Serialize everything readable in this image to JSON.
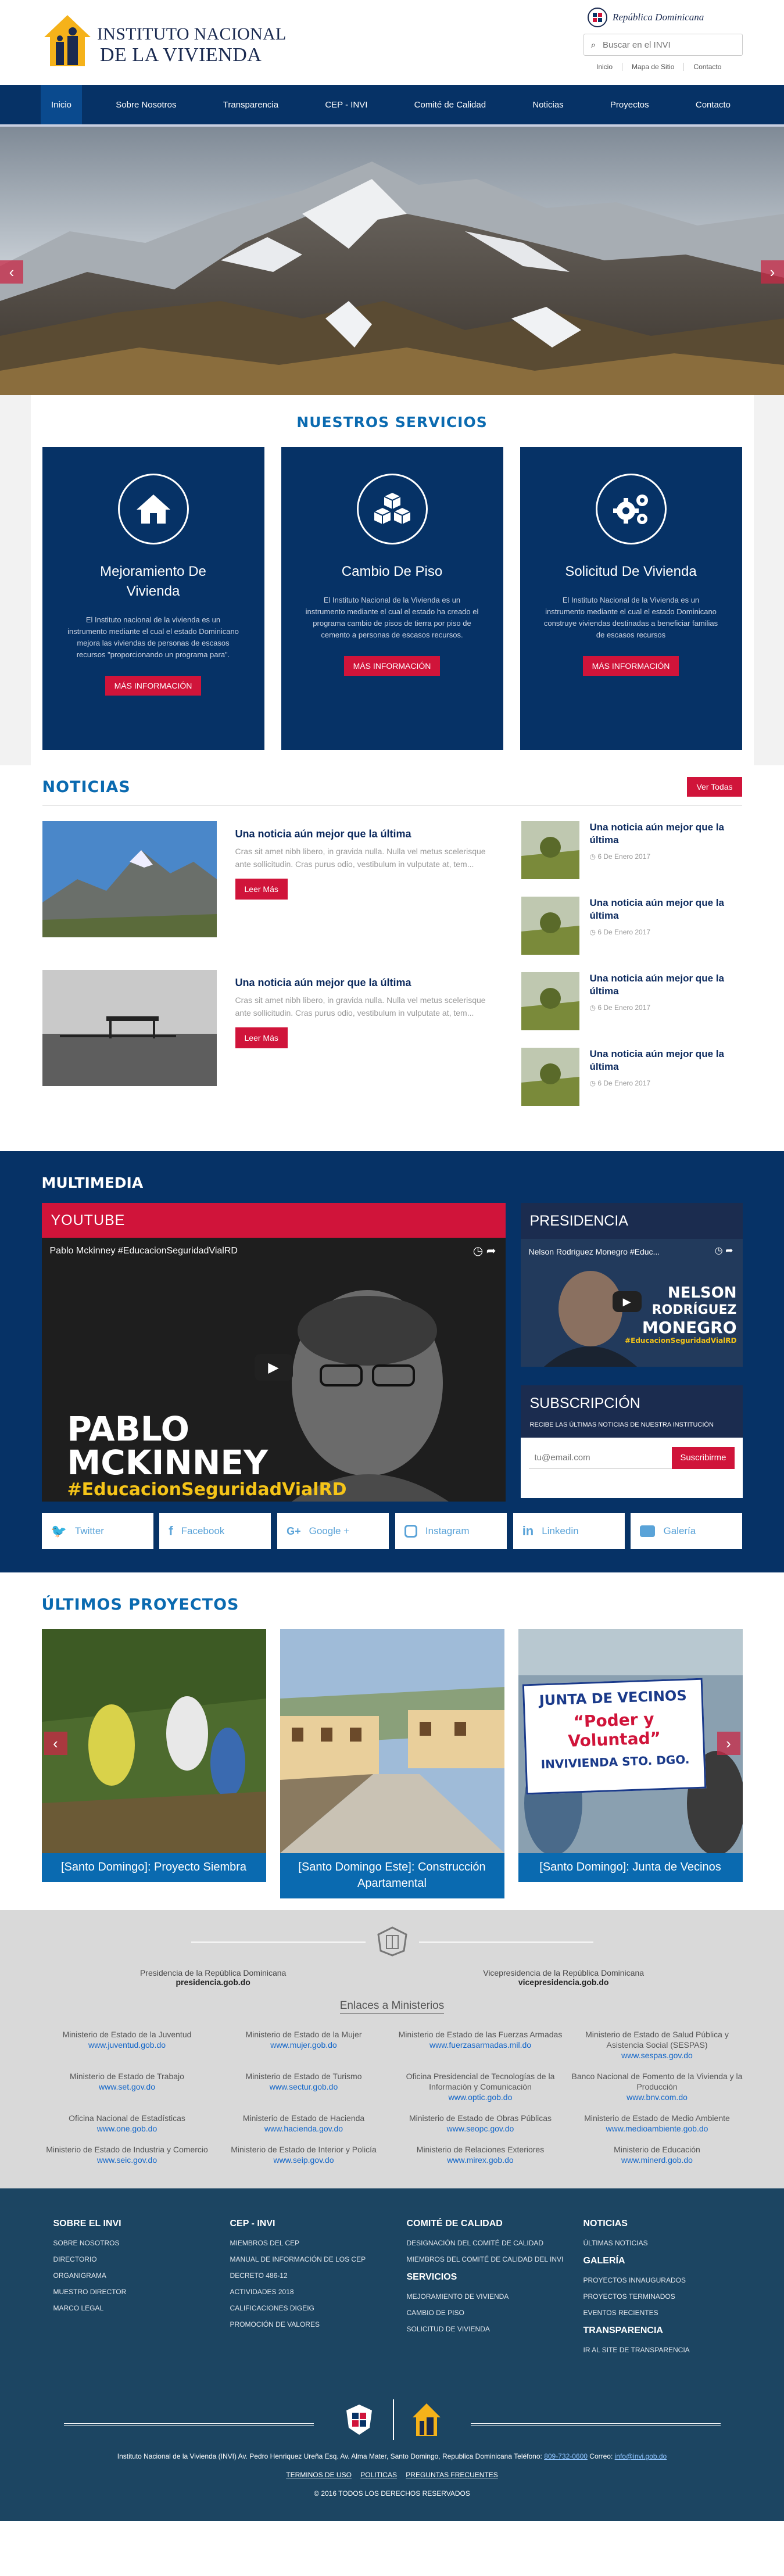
{
  "header": {
    "logo_line1": "INSTITUTO NACIONAL",
    "logo_line2": "DE LA VIVIENDA",
    "rd_label": "República Dominicana",
    "search_placeholder": "Buscar en el INVI",
    "top_links": [
      "Inicio",
      "Mapa de Sitio",
      "Contacto"
    ]
  },
  "nav": [
    "Inicio",
    "Sobre Nosotros",
    "Transparencia",
    "CEP - INVI",
    "Comité de Calidad",
    "Noticias",
    "Proyectos",
    "Contacto"
  ],
  "hero": {
    "prev": "‹",
    "next": "›"
  },
  "services": {
    "title": "NUESTROS SERVICIOS",
    "items": [
      {
        "title": "Mejoramiento De Vivienda",
        "text": "El Instituto nacional de la vivienda es un instrumento mediante el cual el estado Dominicano mejora las viviendas de personas de escasos recursos \"proporcionando un programa para\".",
        "button": "MÁS INFORMACIÓN",
        "icon": "home-icon"
      },
      {
        "title": "Cambio De Piso",
        "text": "El Instituto Nacional de la Vivienda es un instrumento mediante el cual el estado ha creado el programa cambio de pisos de tierra por piso de cemento a personas de escasos recursos.",
        "button": "MÁS INFORMACIÓN",
        "icon": "cubes-icon"
      },
      {
        "title": "Solicitud De Vivienda",
        "text": "El Instituto Nacional de la Vivienda es un instrumento mediante el cual el estado Dominicano construye viviendas destinadas a beneficiar familias de escasos recursos",
        "button": "MÁS INFORMACIÓN",
        "icon": "gears-icon"
      }
    ]
  },
  "news": {
    "title": "NOTICIAS",
    "view_all": "Ver Todas",
    "main": [
      {
        "title": "Una noticia aún mejor que la última",
        "text": "Cras sit amet nibh libero, in gravida nulla. Nulla vel metus scelerisque ante sollicitudin. Cras purus odio, vestibulum in vulputate at, tem...",
        "button": "Leer Más"
      },
      {
        "title": "Una noticia aún mejor que la última",
        "text": "Cras sit amet nibh libero, in gravida nulla. Nulla vel metus scelerisque ante sollicitudin. Cras purus odio, vestibulum in vulputate at, tem...",
        "button": "Leer Más"
      }
    ],
    "side": [
      {
        "title": "Una noticia aún mejor que la última",
        "date": "6 De Enero 2017"
      },
      {
        "title": "Una noticia aún mejor que la última",
        "date": "6 De Enero 2017"
      },
      {
        "title": "Una noticia aún mejor que la última",
        "date": "6 De Enero 2017"
      },
      {
        "title": "Una noticia aún mejor que la última",
        "date": "6 De Enero 2017"
      }
    ]
  },
  "multimedia": {
    "title": "MULTIMEDIA",
    "youtube": {
      "label": "YOUTUBE",
      "video_title": "Pablo Mckinney #EducacionSeguridadVialRD",
      "overlay_name": "PABLO\nMCKINNEY",
      "overlay_tag": "#EducacionSeguridadVialRD"
    },
    "presidencia": {
      "label": "PRESIDENCIA",
      "video_title": "Nelson Rodriguez Monegro #Educ...",
      "overlay_l1": "NELSON",
      "overlay_l2": "RODRÍGUEZ",
      "overlay_l3": "MONEGRO",
      "overlay_tag": "#EducacionSeguridadVialRD"
    },
    "subscription": {
      "label": "SUBSCRIPCIÓN",
      "hint": "RECIBE LAS ÚLTIMAS NOTICIAS DE NUESTRA INSTITUCIÓN",
      "placeholder": "tu@email.com",
      "button": "Suscribirme"
    },
    "social": [
      {
        "label": "Twitter",
        "icon": "twitter-icon"
      },
      {
        "label": "Facebook",
        "icon": "facebook-icon"
      },
      {
        "label": "Google +",
        "icon": "google-plus-icon"
      },
      {
        "label": "Instagram",
        "icon": "instagram-icon"
      },
      {
        "label": "Linkedin",
        "icon": "linkedin-icon"
      },
      {
        "label": "Galería",
        "icon": "camera-icon"
      }
    ]
  },
  "projects": {
    "title": "ÚLTIMOS PROYECTOS",
    "items": [
      {
        "caption": "[Santo Domingo]: Proyecto Siembra"
      },
      {
        "caption": "[Santo Domingo Este]: Construcción Apartamental"
      },
      {
        "caption": "[Santo Domingo]: Junta de Vecinos"
      }
    ],
    "banner_l1": "JUNTA DE VECINOS",
    "banner_l2": "“Poder y Voluntad”",
    "banner_l3": "INVIVIENDA STO. DGO."
  },
  "links": {
    "presidencia": {
      "name": "Presidencia de la República Dominicana",
      "url": "presidencia.gob.do"
    },
    "vicepresidencia": {
      "name": "Vicepresidencia de la República Dominicana",
      "url": "vicepresidencia.gob.do"
    },
    "ministries_title": "Enlaces a Ministerios",
    "ministries": [
      {
        "name": "Ministerio de Estado de la Juventud",
        "url": "www.juventud.gob.do"
      },
      {
        "name": "Ministerio de Estado de la Mujer",
        "url": "www.mujer.gob.do"
      },
      {
        "name": "Ministerio de Estado de las Fuerzas Armadas",
        "url": "www.fuerzasarmadas.mil.do"
      },
      {
        "name": "Ministerio de Estado de Salud Pública y Asistencia Social (SESPAS)",
        "url": "www.sespas.gov.do"
      },
      {
        "name": "Ministerio de Estado de Trabajo",
        "url": "www.set.gov.do"
      },
      {
        "name": "Ministerio de Estado de Turismo",
        "url": "www.sectur.gob.do"
      },
      {
        "name": "Oficina Presidencial de Tecnologías de la Información y Comunicación",
        "url": "www.optic.gob.do"
      },
      {
        "name": "Banco Nacional de Fomento de la Vivienda y la Producción",
        "url": "www.bnv.com.do"
      },
      {
        "name": "Oficina Nacional de Estadísticas",
        "url": "www.one.gob.do"
      },
      {
        "name": "Ministerio de Estado de Hacienda",
        "url": "www.hacienda.gov.do"
      },
      {
        "name": "Ministerio de Estado de Obras Públicas",
        "url": "www.seopc.gov.do"
      },
      {
        "name": "Ministerio de Estado de Medio Ambiente",
        "url": "www.medioambiente.gob.do"
      },
      {
        "name": "Ministerio de Estado de Industria y Comercio",
        "url": "www.seic.gov.do"
      },
      {
        "name": "Ministerio de Estado de Interior y Policía",
        "url": "www.seip.gov.do"
      },
      {
        "name": "Ministerio de Relaciones Exteriores",
        "url": "www.mirex.gob.do"
      },
      {
        "name": "Ministerio de Educación",
        "url": "www.minerd.gob.do"
      }
    ]
  },
  "footer": {
    "columns": [
      {
        "groups": [
          {
            "title": "SOBRE EL INVI",
            "items": [
              "SOBRE NOSOTROS",
              "DIRECTORIO",
              "ORGANIGRAMA",
              "MUESTRO DIRECTOR",
              "MARCO LEGAL"
            ]
          }
        ]
      },
      {
        "groups": [
          {
            "title": "CEP - INVI",
            "items": [
              "MIEMBROS DEL CEP",
              "MANUAL DE INFORMACIÓN DE LOS CEP",
              "DECRETO 486-12",
              "ACTIVIDADES 2018",
              "CALIFICACIONES DIGEIG",
              "PROMOCIÓN DE VALORES"
            ]
          }
        ]
      },
      {
        "groups": [
          {
            "title": "COMITÉ DE CALIDAD",
            "items": [
              "DESIGNACIÓN DEL COMITÉ DE CALIDAD",
              "MIEMBROS DEL COMITÉ DE CALIDAD DEL INVI"
            ]
          },
          {
            "title": "SERVICIOS",
            "items": [
              "MEJORAMIENTO DE VIVIENDA",
              "CAMBIO DE PISO",
              "SOLICITUD DE VIVIENDA"
            ]
          }
        ]
      },
      {
        "groups": [
          {
            "title": "NOTICIAS",
            "items": [
              "ÚLTIMAS NOTICIAS"
            ]
          },
          {
            "title": "GALERÍA",
            "items": [
              "PROYECTOS INNAUGURADOS",
              "PROYECTOS TERMINADOS",
              "EVENTOS RECIENTES"
            ]
          },
          {
            "title": "TRANSPARENCIA",
            "items": [
              "IR AL SITE DE TRANSPARENCIA"
            ]
          }
        ]
      }
    ],
    "address": "Instituto Nacional de la Vivienda (INVI) Av. Pedro Henriquez Ureña Esq. Av. Alma Mater, Santo Domingo, Republica Dominicana Teléfono:",
    "phone": "809-732-0600",
    "email_label": "Correo:",
    "email": "info@invi.gob.do",
    "legal": [
      "TERMINOS DE USO",
      "POLITICAS",
      "PREGUNTAS FRECUENTES"
    ],
    "copyright": "© 2016 TODOS LOS DERECHOS RESERVADOS"
  }
}
